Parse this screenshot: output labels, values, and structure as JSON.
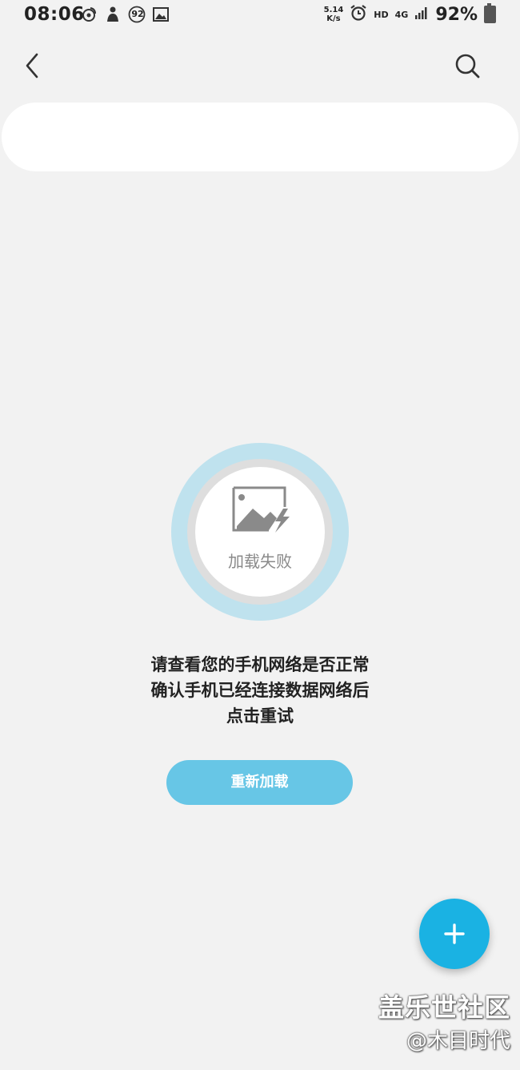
{
  "status_bar": {
    "time": "08:06",
    "notification_badge": "92",
    "speed_value": "5.14",
    "speed_unit": "K/s",
    "hd": "HD",
    "network": "4G",
    "battery": "92%"
  },
  "header": {
    "back_icon": "chevron-left-icon",
    "search_icon": "search-icon"
  },
  "error": {
    "status_label": "加载失败",
    "message_lines": [
      "请查看您的手机网络是否正常",
      "确认手机已经连接数据网络后",
      "点击重试"
    ],
    "retry_label": "重新加载"
  },
  "fab": {
    "icon": "plus-icon"
  },
  "watermark": {
    "line1": "盖乐世社区",
    "line2": "@木目时代"
  },
  "colors": {
    "background": "#f2f2f2",
    "accent": "#1ab2e3",
    "retry_button": "#67c6e6",
    "ring_outer": "#bfe2ee"
  }
}
